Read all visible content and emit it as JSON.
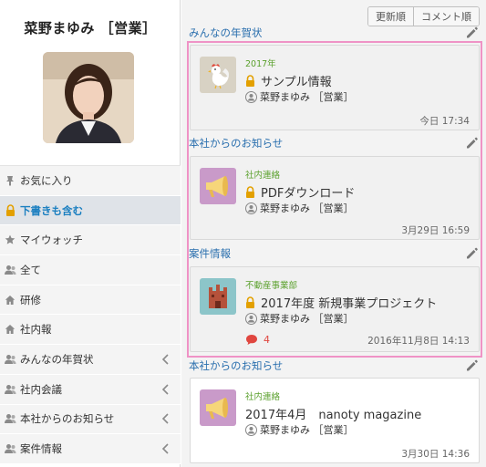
{
  "profile": {
    "name": "菜野まゆみ ［営業］"
  },
  "sidebar": {
    "items": [
      {
        "label": "お気に入り",
        "icon": "pin-icon",
        "active": false,
        "expandable": false
      },
      {
        "label": "下書きも含む",
        "icon": "lock-icon",
        "active": true,
        "expandable": false
      },
      {
        "label": "マイウォッチ",
        "icon": "star-icon",
        "active": false,
        "expandable": false
      },
      {
        "label": "全て",
        "icon": "people-icon",
        "active": false,
        "expandable": false
      },
      {
        "label": "研修",
        "icon": "house-icon",
        "active": false,
        "expandable": false
      },
      {
        "label": "社内報",
        "icon": "house-icon",
        "active": false,
        "expandable": false
      },
      {
        "label": "みんなの年賀状",
        "icon": "people-icon",
        "active": false,
        "expandable": true
      },
      {
        "label": "社内会議",
        "icon": "people-icon",
        "active": false,
        "expandable": true
      },
      {
        "label": "本社からのお知らせ",
        "icon": "people-icon",
        "active": false,
        "expandable": true
      },
      {
        "label": "案件情報",
        "icon": "people-icon",
        "active": false,
        "expandable": true
      }
    ]
  },
  "sort": {
    "newest_label": "更新順",
    "comment_label": "コメント順"
  },
  "feed": [
    {
      "section": "みんなの年賀状",
      "category": "2017年",
      "title": "サンプル情報",
      "locked": true,
      "author": "菜野まゆみ ［営業］",
      "time": "今日 17:34",
      "comments": null,
      "icon": "rooster-icon",
      "icon_bg": "#d8d2c4"
    },
    {
      "section": "本社からのお知らせ",
      "category": "社内連絡",
      "title": "PDFダウンロード",
      "locked": true,
      "author": "菜野まゆみ ［営業］",
      "time": "3月29日 16:59",
      "comments": null,
      "icon": "megaphone-icon",
      "icon_bg": "#c99ac9"
    },
    {
      "section": "案件情報",
      "category": "不動産事業部",
      "title": "2017年度 新規事業プロジェクト",
      "locked": true,
      "author": "菜野まゆみ ［営業］",
      "time": "2016年11月8日 14:13",
      "comments": "4",
      "icon": "castle-icon",
      "icon_bg": "#8cc5c9"
    },
    {
      "section": "本社からのお知らせ",
      "category": "社内連絡",
      "title": "2017年4月　nanoty magazine",
      "locked": false,
      "author": "菜野まゆみ ［営業］",
      "time": "3月30日 14:36",
      "comments": null,
      "icon": "megaphone-icon",
      "icon_bg": "#c99ac9"
    }
  ],
  "colors": {
    "accent_blue": "#2a6fae",
    "category_green": "#5aa02c",
    "highlight_pink": "#ef93c6",
    "lock_orange": "#e3a000",
    "comment_red": "#e0463f"
  }
}
